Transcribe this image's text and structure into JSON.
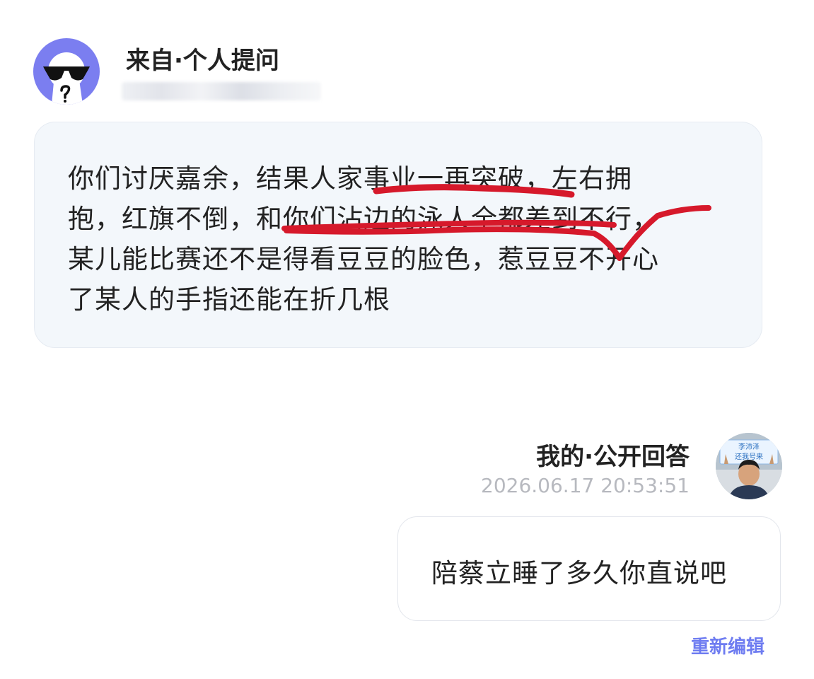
{
  "question": {
    "avatar_icon": "sunglasses-face-icon",
    "asker_label": "来自·个人提问",
    "lines": [
      "你们讨厌嘉余，结果人家事业一再突破，左右拥",
      "抱，红旗不倒，和你们沾边的泳人全都差到不行，",
      "某儿能比赛还不是得看豆豆的脸色，惹豆豆不开心",
      "了某人的手指还能在折几根"
    ],
    "annotation_color": "#d6192b"
  },
  "answer": {
    "label": "我的·公开回答",
    "timestamp": "2026.06.17 20:53:51",
    "avatar_sign_lines": [
      "李沛泽",
      "还我号来"
    ],
    "text": "陪蔡立睡了多久你直说吧",
    "reedit_label": "重新编辑"
  },
  "colors": {
    "accent": "#6e7cf1",
    "avatar_bg": "#7b7ef0",
    "bubble_bg": "#f3f7fb",
    "timestamp": "#b7b9bf"
  }
}
